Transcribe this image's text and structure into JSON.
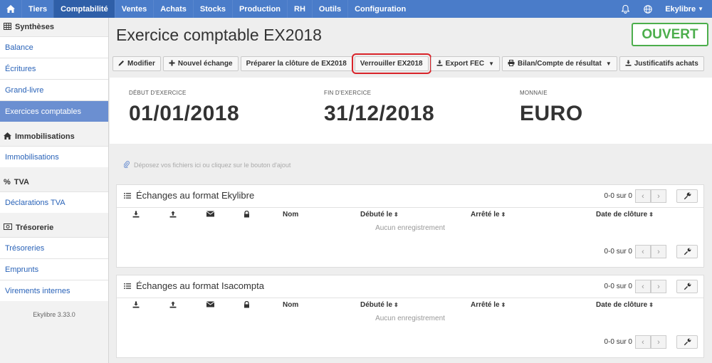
{
  "nav": {
    "items": [
      "Tiers",
      "Comptabilité",
      "Ventes",
      "Achats",
      "Stocks",
      "Production",
      "RH",
      "Outils",
      "Configuration"
    ],
    "active": "Comptabilité",
    "user": "Ekylibre"
  },
  "sidebar": {
    "sections": [
      {
        "title": "Synthèses",
        "items": [
          "Balance",
          "Écritures",
          "Grand-livre",
          "Exercices comptables"
        ]
      },
      {
        "title": "Immobilisations",
        "items": [
          "Immobilisations"
        ]
      },
      {
        "title": "TVA",
        "items": [
          "Déclarations TVA"
        ]
      },
      {
        "title": "Trésorerie",
        "items": [
          "Trésoreries",
          "Emprunts",
          "Virements internes"
        ]
      }
    ],
    "active_item": "Exercices comptables",
    "version": "Ekylibre 3.33.0"
  },
  "header": {
    "title": "Exercice comptable EX2018",
    "status": "OUVERT",
    "status_color": "#4cae4c"
  },
  "toolbar": {
    "modify": "Modifier",
    "new_exchange": "Nouvel échange",
    "prepare_closure": "Préparer la clôture de EX2018",
    "lock": "Verrouiller EX2018",
    "export_fec": "Export FEC",
    "balance": "Bilan/Compte de résultat",
    "justifs": "Justificatifs achats"
  },
  "info": {
    "start_label": "DÉBUT D'EXERCICE",
    "start_value": "01/01/2018",
    "end_label": "FIN D'EXERCICE",
    "end_value": "31/12/2018",
    "currency_label": "MONNAIE",
    "currency_value": "EURO"
  },
  "dropzone": {
    "text": "Déposez vos fichiers ici ou cliquez sur le bouton d'ajout"
  },
  "panels": [
    {
      "title": "Échanges au format Ekylibre",
      "count_top": "0-0 sur 0",
      "count_bottom": "0-0 sur 0",
      "columns": [
        "Nom",
        "Débuté le",
        "Arrêté le",
        "Date de clôture"
      ],
      "empty": "Aucun enregistrement"
    },
    {
      "title": "Échanges au format Isacompta",
      "count_top": "0-0 sur 0",
      "count_bottom": "0-0 sur 0",
      "columns": [
        "Nom",
        "Débuté le",
        "Arrêté le",
        "Date de clôture"
      ],
      "empty": "Aucun enregistrement"
    }
  ],
  "colors": {
    "nav": "#4a7cc9",
    "nav_active": "#2f5fa8",
    "link": "#2a63b8",
    "sidebar_active": "#6b8fd1",
    "highlight": "#d9242a"
  }
}
